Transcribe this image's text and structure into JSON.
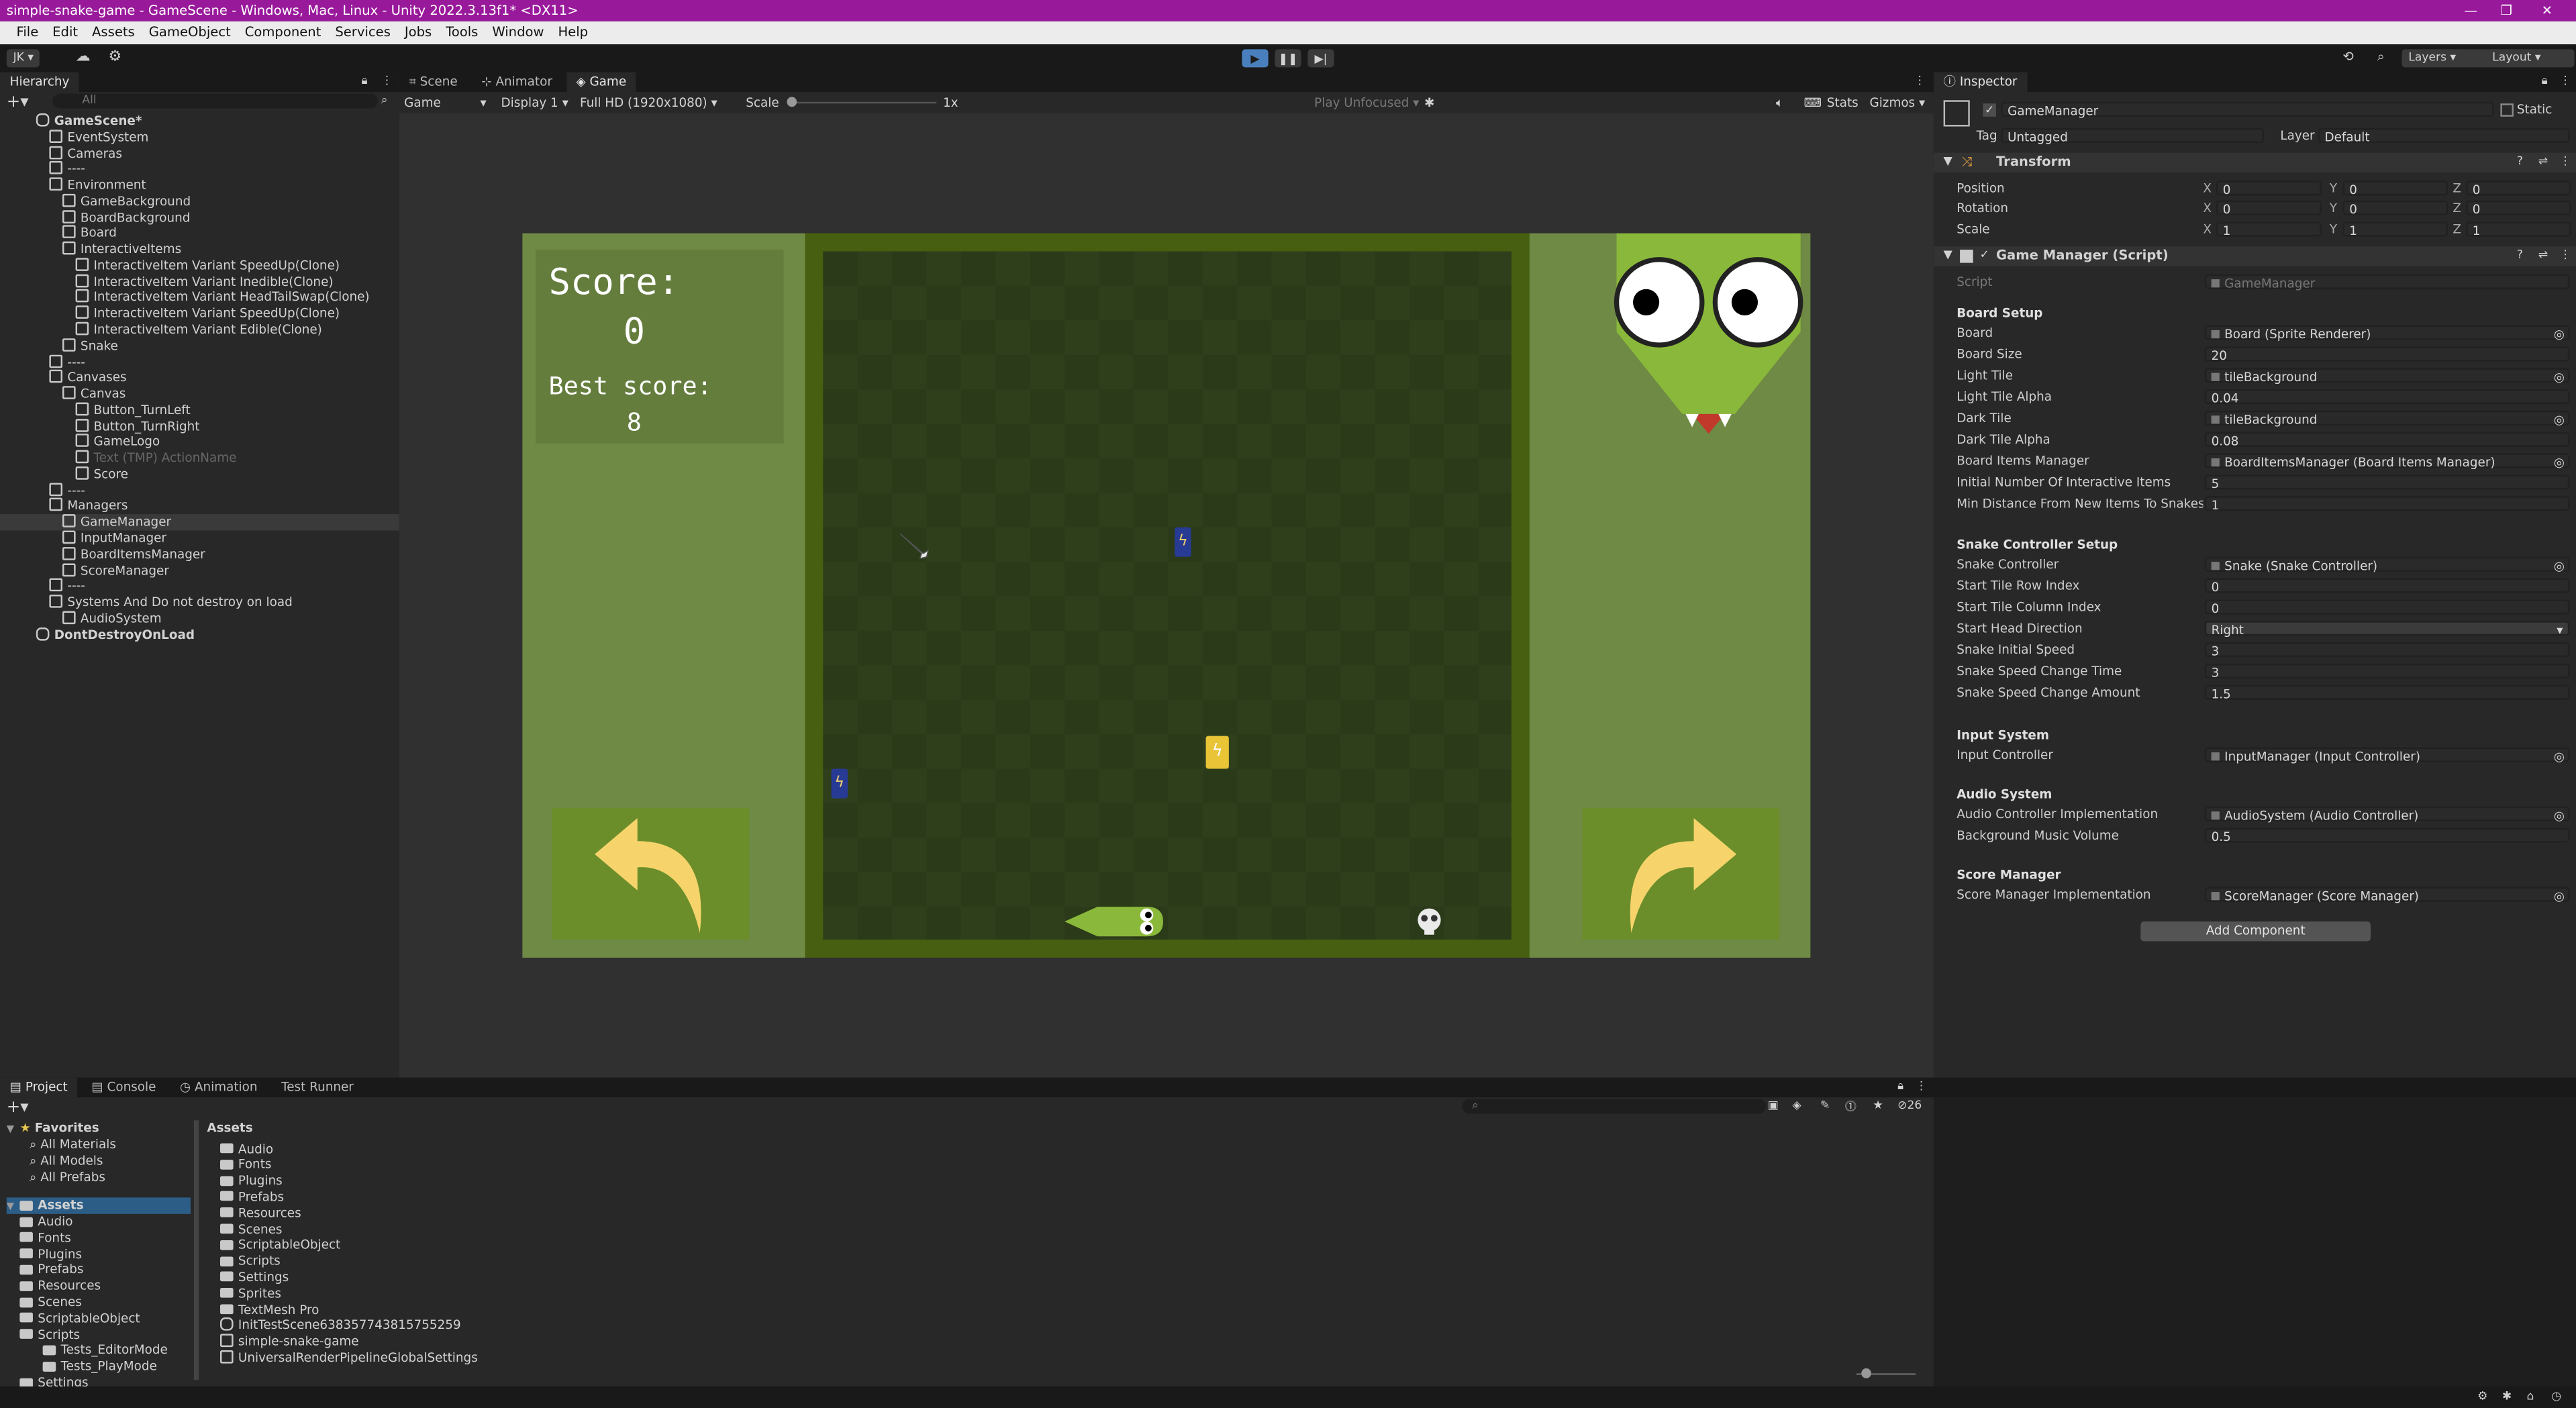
{
  "window": {
    "title": "simple-snake-game - GameScene - Windows, Mac, Linux - Unity 2022.3.13f1* <DX11>"
  },
  "menu": [
    "File",
    "Edit",
    "Assets",
    "GameObject",
    "Component",
    "Services",
    "Jobs",
    "Tools",
    "Window",
    "Help"
  ],
  "toolbar": {
    "account": "JK",
    "layers": "Layers",
    "layout": "Layout"
  },
  "hierarchy": {
    "tab": "Hierarchy",
    "search_placeholder": "All",
    "items": [
      {
        "label": "GameScene*",
        "depth": 0,
        "type": "scene"
      },
      {
        "label": "EventSystem",
        "depth": 1
      },
      {
        "label": "Cameras",
        "depth": 1
      },
      {
        "label": "----",
        "depth": 1
      },
      {
        "label": "Environment",
        "depth": 1
      },
      {
        "label": "GameBackground",
        "depth": 2
      },
      {
        "label": "BoardBackground",
        "depth": 2
      },
      {
        "label": "Board",
        "depth": 2
      },
      {
        "label": "InteractiveItems",
        "depth": 2
      },
      {
        "label": "InteractiveItem Variant SpeedUp(Clone)",
        "depth": 3
      },
      {
        "label": "InteractiveItem Variant Inedible(Clone)",
        "depth": 3
      },
      {
        "label": "InteractiveItem Variant HeadTailSwap(Clone)",
        "depth": 3
      },
      {
        "label": "InteractiveItem Variant SpeedUp(Clone)",
        "depth": 3
      },
      {
        "label": "InteractiveItem Variant Edible(Clone)",
        "depth": 3
      },
      {
        "label": "Snake",
        "depth": 2
      },
      {
        "label": "----",
        "depth": 1
      },
      {
        "label": "Canvases",
        "depth": 1
      },
      {
        "label": "Canvas",
        "depth": 2
      },
      {
        "label": "Button_TurnLeft",
        "depth": 3
      },
      {
        "label": "Button_TurnRight",
        "depth": 3
      },
      {
        "label": "GameLogo",
        "depth": 3
      },
      {
        "label": "Text (TMP) ActionName",
        "depth": 3,
        "dim": true
      },
      {
        "label": "Score",
        "depth": 3
      },
      {
        "label": "----",
        "depth": 1
      },
      {
        "label": "Managers",
        "depth": 1
      },
      {
        "label": "GameManager",
        "depth": 2,
        "selected": true
      },
      {
        "label": "InputManager",
        "depth": 2
      },
      {
        "label": "BoardItemsManager",
        "depth": 2
      },
      {
        "label": "ScoreManager",
        "depth": 2
      },
      {
        "label": "----",
        "depth": 1
      },
      {
        "label": "Systems And Do not destroy on load",
        "depth": 1
      },
      {
        "label": "AudioSystem",
        "depth": 2
      },
      {
        "label": "DontDestroyOnLoad",
        "depth": 0,
        "type": "scene"
      }
    ]
  },
  "center_tabs": [
    "Scene",
    "Animator",
    "Game"
  ],
  "game_bar": {
    "mode": "Game",
    "display": "Display 1",
    "resolution": "Full HD (1920x1080)",
    "scale_label": "Scale",
    "scale_value": "1x",
    "play_mode": "Play Unfocused",
    "stats": "Stats",
    "gizmos": "Gizmos"
  },
  "game": {
    "score_label": "Score:",
    "score": "0",
    "best_label": "Best score:",
    "best": "8"
  },
  "inspector": {
    "tab": "Inspector",
    "object_name": "GameManager",
    "static": "Static",
    "tag_label": "Tag",
    "tag": "Untagged",
    "layer_label": "Layer",
    "layer": "Default",
    "transform_title": "Transform",
    "transform": [
      {
        "label": "Position",
        "x": "0",
        "y": "0",
        "z": "0"
      },
      {
        "label": "Rotation",
        "x": "0",
        "y": "0",
        "z": "0"
      },
      {
        "label": "Scale",
        "x": "1",
        "y": "1",
        "z": "1"
      }
    ],
    "component_title": "Game Manager (Script)",
    "script_label": "Script",
    "script_value": "GameManager",
    "sections": [
      {
        "header": "Board Setup",
        "fields": [
          {
            "label": "Board",
            "value": "Board (Sprite Renderer)",
            "obj": true
          },
          {
            "label": "Board Size",
            "value": "20"
          },
          {
            "label": "Light Tile",
            "value": "tileBackground",
            "obj": true
          },
          {
            "label": "Light Tile Alpha",
            "value": "0.04"
          },
          {
            "label": "Dark Tile",
            "value": "tileBackground",
            "obj": true
          },
          {
            "label": "Dark Tile Alpha",
            "value": "0.08"
          },
          {
            "label": "Board Items Manager",
            "value": "BoardItemsManager (Board Items Manager)",
            "obj": true
          },
          {
            "label": "Initial Number Of Interactive Items",
            "value": "5"
          },
          {
            "label": "Min Distance From New Items To Snakes H",
            "value": "1"
          }
        ]
      },
      {
        "header": "Snake Controller Setup",
        "fields": [
          {
            "label": "Snake Controller",
            "value": "Snake (Snake Controller)",
            "obj": true
          },
          {
            "label": "Start Tile Row Index",
            "value": "0"
          },
          {
            "label": "Start Tile Column Index",
            "value": "0"
          },
          {
            "label": "Start Head Direction",
            "value": "Right",
            "dropdown": true
          },
          {
            "label": "Snake Initial Speed",
            "value": "3"
          },
          {
            "label": "Snake Speed Change Time",
            "value": "3"
          },
          {
            "label": "Snake Speed Change Amount",
            "value": "1.5"
          }
        ]
      },
      {
        "header": "Input System",
        "fields": [
          {
            "label": "Input Controller",
            "value": "InputManager (Input Controller)",
            "obj": true
          }
        ]
      },
      {
        "header": "Audio System",
        "fields": [
          {
            "label": "Audio Controller Implementation",
            "value": "AudioSystem (Audio Controller)",
            "obj": true
          },
          {
            "label": "Background Music Volume",
            "value": "0.5"
          }
        ]
      },
      {
        "header": "Score Manager",
        "fields": [
          {
            "label": "Score Manager Implementation",
            "value": "ScoreManager (Score Manager)",
            "obj": true
          }
        ]
      }
    ],
    "add_component": "Add Component"
  },
  "bottom_tabs": [
    "Project",
    "Console",
    "Animation",
    "Test Runner"
  ],
  "project": {
    "hidden_count": "26",
    "favorites_title": "Favorites",
    "favorites": [
      "All Materials",
      "All Models",
      "All Prefabs"
    ],
    "assets_title": "Assets",
    "tree": [
      "Audio",
      "Fonts",
      "Plugins",
      "Prefabs",
      "Resources",
      "Scenes",
      "ScriptableObject",
      "Scripts",
      "Tests_EditorMode",
      "Tests_PlayMode",
      "Settings"
    ],
    "breadcrumb": "Assets",
    "files": [
      {
        "label": "Audio",
        "kind": "folder"
      },
      {
        "label": "Fonts",
        "kind": "folder"
      },
      {
        "label": "Plugins",
        "kind": "folder"
      },
      {
        "label": "Prefabs",
        "kind": "folder"
      },
      {
        "label": "Resources",
        "kind": "folder"
      },
      {
        "label": "Scenes",
        "kind": "folder"
      },
      {
        "label": "ScriptableObject",
        "kind": "folder"
      },
      {
        "label": "Scripts",
        "kind": "folder"
      },
      {
        "label": "Settings",
        "kind": "folder"
      },
      {
        "label": "Sprites",
        "kind": "folder"
      },
      {
        "label": "TextMesh Pro",
        "kind": "folder"
      },
      {
        "label": "InitTestScene638357743815755259",
        "kind": "scene"
      },
      {
        "label": "simple-snake-game",
        "kind": "asset"
      },
      {
        "label": "UniversalRenderPipelineGlobalSettings",
        "kind": "asset"
      }
    ]
  },
  "colors": {
    "title_bar": "#99199b",
    "panel": "#282828",
    "game_bg": "#6e8a44",
    "board_dark": "#2b3a19",
    "board_border": "#465f10",
    "button": "#6b8e2a",
    "arrow": "#f6d46b",
    "snake": "#8ab83a"
  }
}
